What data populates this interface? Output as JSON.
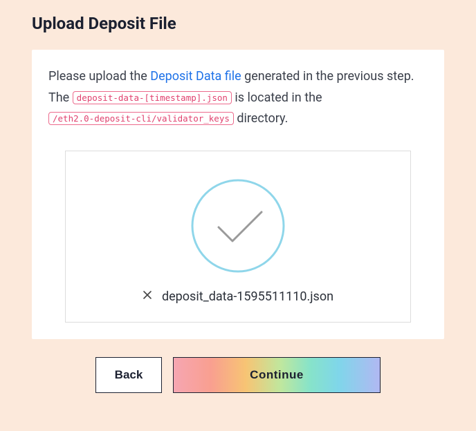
{
  "title": "Upload Deposit File",
  "instructions": {
    "part1": "Please upload the ",
    "link_text": "Deposit Data file",
    "part2": " generated in the previous step. The ",
    "code1": "deposit-data-[timestamp].json",
    "part3": " is located in the ",
    "code2": "/eth2.0-deposit-cli/validator_keys",
    "part4": " directory."
  },
  "uploaded_file": {
    "name": "deposit_data-1595511110.json"
  },
  "buttons": {
    "back": "Back",
    "continue": "Continue"
  },
  "colors": {
    "check_circle_stroke": "#8fd6ea",
    "checkmark_stroke": "#9a9a9a"
  }
}
